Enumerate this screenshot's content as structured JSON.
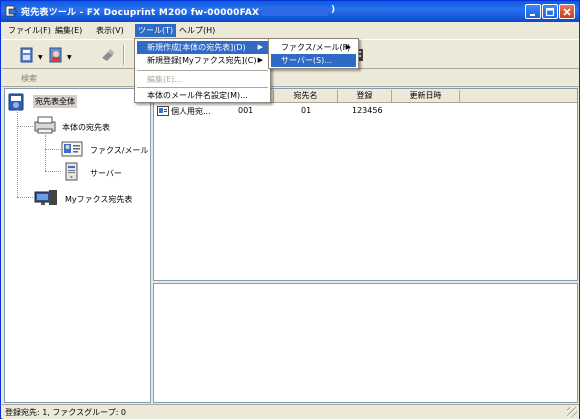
{
  "window": {
    "title": "宛先表ツール - FX Docuprint M200 fw-00000FAX (",
    "title_end": ")"
  },
  "menubar": {
    "items": [
      {
        "label": "ファイル(F)"
      },
      {
        "label": "編集(E)"
      },
      {
        "label": "表示(V)"
      },
      {
        "label": "ツール(T)"
      },
      {
        "label": "ヘルプ(H)"
      }
    ]
  },
  "tools_menu": {
    "items": [
      {
        "label": "新規作成[本体の宛先表](D)"
      },
      {
        "label": "新規登録[Myファクス宛先](C)"
      },
      {
        "label": "編集(E)..."
      },
      {
        "label": "本体のメール件名設定(M)..."
      }
    ]
  },
  "new_submenu": {
    "items": [
      {
        "label": "ファクス/メール(F)"
      },
      {
        "label": "サーバー(S)..."
      }
    ]
  },
  "search": {
    "label": "検索"
  },
  "tree": {
    "root": "宛先表全体",
    "main_book": "本体の宛先表",
    "fax_mail": "ファクス/メール",
    "server": "サーバー",
    "my_fax": "Myファクス宛先表"
  },
  "list": {
    "columns": [
      "",
      "",
      "宛先名",
      "登録",
      "更新日時"
    ],
    "rows": [
      {
        "name": "個人用宛...",
        "num": "001",
        "dest": "01",
        "reg": "123456",
        "updated": ""
      }
    ]
  },
  "status": {
    "text": "登録宛先: 1, ファクスグループ: 0"
  },
  "colors": {
    "titlebar": "#0a5ce0",
    "menu_highlight": "#316ac5",
    "face": "#ece9d8"
  }
}
